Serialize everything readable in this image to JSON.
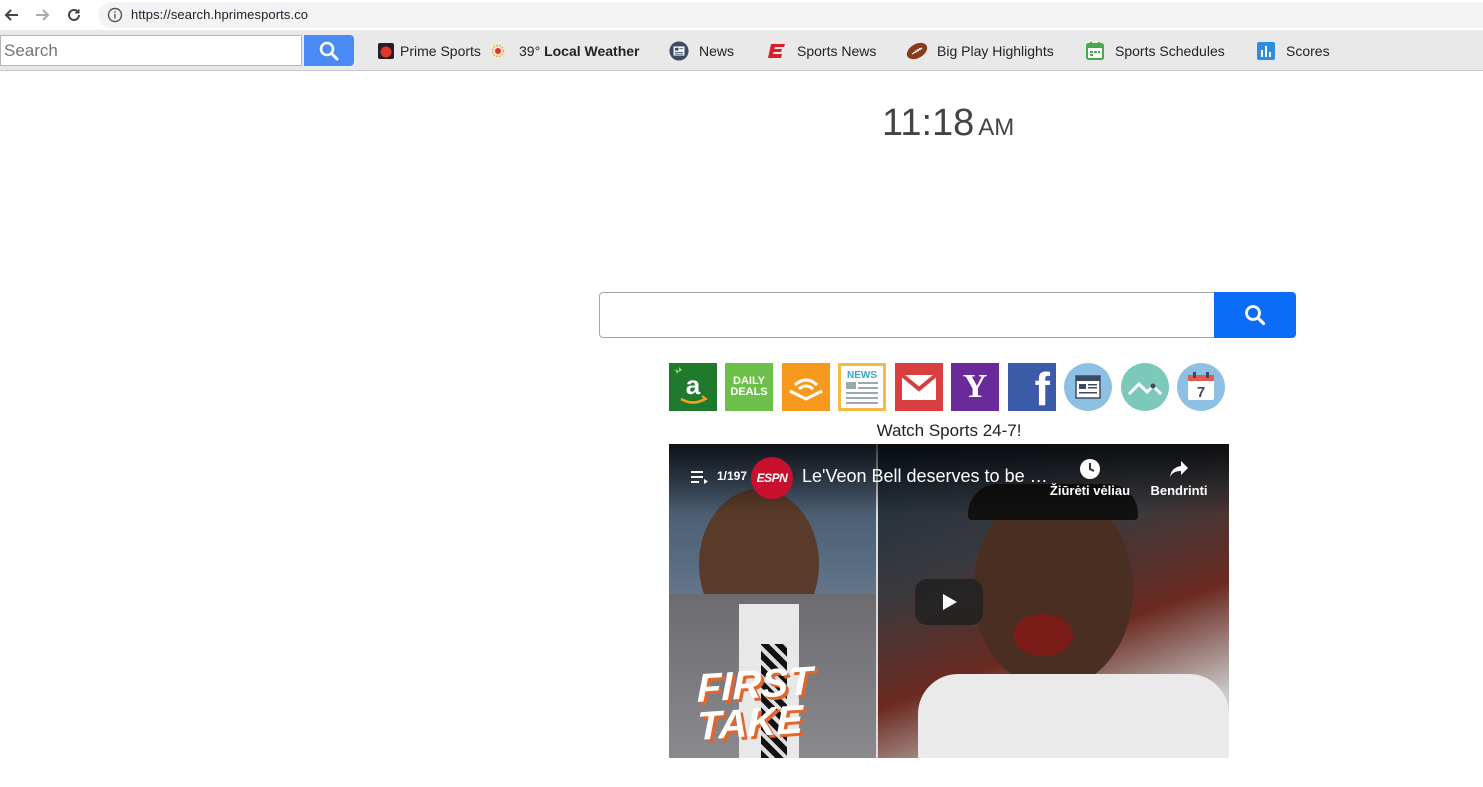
{
  "browser": {
    "url": "https://search.hprimesports.co"
  },
  "toolbar": {
    "search_placeholder": "Search",
    "items": [
      {
        "label": "Prime Sports",
        "icon": "prime-sports-icon"
      },
      {
        "label_prefix": "39°",
        "label": "Local Weather",
        "icon": "weather-sun-icon"
      },
      {
        "label": "News",
        "icon": "news-icon"
      },
      {
        "label": "Sports News",
        "icon": "espn-e-icon"
      },
      {
        "label": "Big Play Highlights",
        "icon": "football-icon"
      },
      {
        "label": "Sports Schedules",
        "icon": "calendar-icon"
      },
      {
        "label": "Scores",
        "icon": "bar-chart-icon"
      }
    ]
  },
  "clock": {
    "time": "11:18",
    "ampm": "AM"
  },
  "tiles": [
    {
      "name": "amazon-tile",
      "text": "a",
      "color": "#1f7a2e"
    },
    {
      "name": "daily-deals-tile",
      "text_line1": "DAILY",
      "text_line2": "DEALS",
      "color": "#6cc04a"
    },
    {
      "name": "audible-tile",
      "color": "#f7991c"
    },
    {
      "name": "news-tile",
      "text": "NEWS",
      "color": "#f6b941"
    },
    {
      "name": "gmail-tile",
      "color": "#d93f3f"
    },
    {
      "name": "yahoo-tile",
      "text": "Y",
      "color": "#6b2a9b"
    },
    {
      "name": "facebook-tile",
      "text": "f",
      "color": "#3b5ba8"
    },
    {
      "name": "newspaper-tile",
      "color": "#8ec0e4"
    },
    {
      "name": "stocks-tile",
      "color": "#7cc9b9"
    },
    {
      "name": "calendar-tile",
      "text": "7",
      "color": "#8ec0e4"
    }
  ],
  "watch_label": "Watch Sports 24-7!",
  "video": {
    "playlist_count": "1/197",
    "channel": "ESPN",
    "title": "Le'Veon Bell deserves to be …",
    "watch_later": "Žiūrėti vėliau",
    "share": "Bendrinti",
    "overlay_text_line1": "FIRST",
    "overlay_text_line2": "TAKE"
  }
}
